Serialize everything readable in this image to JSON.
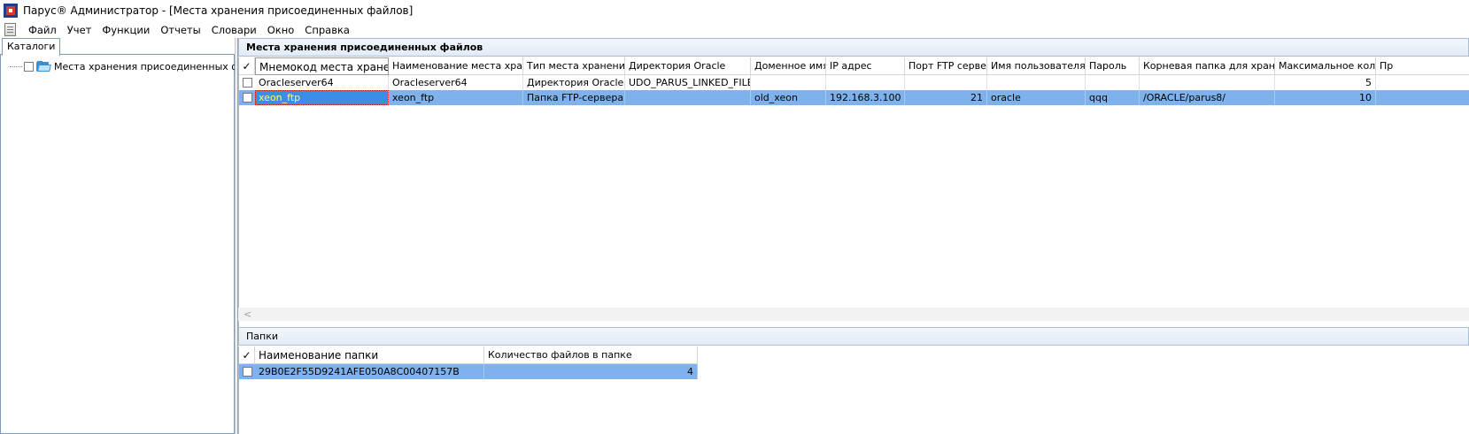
{
  "window": {
    "title": "Парус® Администратор - [Места хранения присоединенных файлов]"
  },
  "menu": {
    "items": [
      "Файл",
      "Учет",
      "Функции",
      "Отчеты",
      "Словари",
      "Окно",
      "Справка"
    ]
  },
  "left_panel": {
    "tab_label": "Каталоги",
    "tree_item": "Места хранения присоединенных файлов"
  },
  "main": {
    "section_title": "Места хранения присоединенных файлов",
    "check_header": "✓",
    "columns": [
      "Мнемокод места хранения",
      "Наименование места хранения",
      "Тип места хранения",
      "Директория Oracle",
      "Доменное имя",
      "IP адрес",
      "Порт FTP сервера",
      "Имя пользователя",
      "Пароль",
      "Корневая папка для хранения",
      "Максимальное количе",
      "Пр"
    ],
    "rows": [
      {
        "mnemo": "Oracleserver64",
        "name": "Oracleserver64",
        "type": "Директория Oracle",
        "oracle_dir": "UDO_PARUS_LINKED_FILES",
        "domain": "",
        "ip": "",
        "port": "",
        "user": "",
        "password": "",
        "root": "",
        "max": "5",
        "pr": ""
      },
      {
        "mnemo": "xeon_ftp",
        "name": "xeon_ftp",
        "type": "Папка FTP-сервера",
        "oracle_dir": "",
        "domain": "old_xeon",
        "ip": "192.168.3.100",
        "port": "21",
        "user": "oracle",
        "password": "qqq",
        "root": "/ORACLE/parus8/",
        "max": "10",
        "pr": ""
      }
    ],
    "scroll_left_glyph": "<"
  },
  "folders": {
    "section_title": "Папки",
    "check_header": "✓",
    "columns": [
      "Наименование папки",
      "Количество файлов в папке"
    ],
    "rows": [
      {
        "name": "29B0E2F55D9241AFE050A8C00407157B",
        "count": "4"
      }
    ]
  }
}
